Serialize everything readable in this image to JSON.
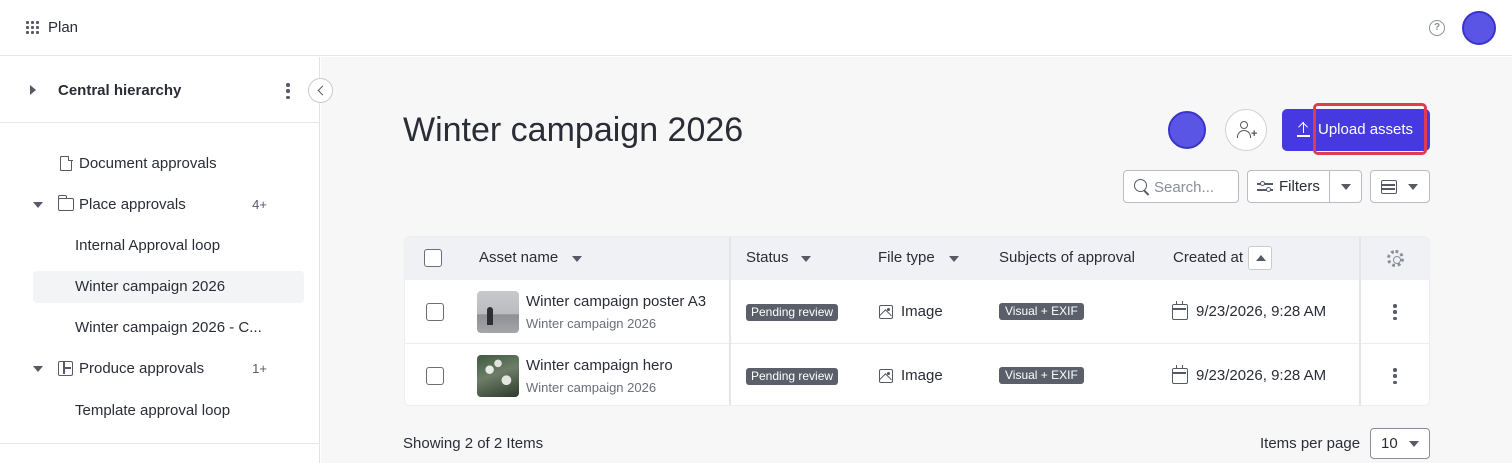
{
  "topbar": {
    "app_name": "Plan"
  },
  "sidebar": {
    "title": "Central hierarchy",
    "items": [
      {
        "label": "Document approvals",
        "count": ""
      },
      {
        "label": "Place approvals",
        "count": "4+"
      },
      {
        "label": "Internal Approval loop",
        "count": ""
      },
      {
        "label": "Winter campaign 2026",
        "count": ""
      },
      {
        "label": "Winter campaign 2026 - C...",
        "count": ""
      },
      {
        "label": "Produce approvals",
        "count": "1+"
      },
      {
        "label": "Template approval loop",
        "count": ""
      }
    ]
  },
  "main": {
    "title": "Winter campaign 2026",
    "upload_label": "Upload assets",
    "search_placeholder": "Search...",
    "filters_label": "Filters"
  },
  "table": {
    "columns": [
      "Asset name",
      "Status",
      "File type",
      "Subjects of approval",
      "Created at"
    ],
    "rows": [
      {
        "name": "Winter campaign poster A3",
        "sub": "Winter campaign 2026",
        "status": "Pending review",
        "file_type": "Image",
        "subject": "Visual + EXIF",
        "created": "9/23/2026, 9:28 AM"
      },
      {
        "name": "Winter campaign hero",
        "sub": "Winter campaign 2026",
        "status": "Pending review",
        "file_type": "Image",
        "subject": "Visual + EXIF",
        "created": "9/23/2026, 9:28 AM"
      }
    ]
  },
  "footer": {
    "showing": "Showing 2 of 2 Items",
    "items_per_page_label": "Items per page",
    "items_per_page_value": "10"
  },
  "colors": {
    "accent": "#4639e0",
    "highlight": "#e23a4e",
    "pill": "#5b5f6a"
  }
}
